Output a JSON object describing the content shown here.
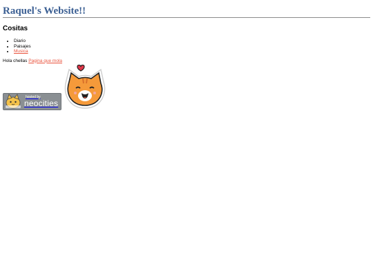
{
  "site": {
    "title": "Raquel's Website!!"
  },
  "cositas": {
    "heading": "Cositas",
    "items": [
      {
        "label": "Diario",
        "is_link": false
      },
      {
        "label": "Paisajes",
        "is_link": false
      },
      {
        "label": "Musica",
        "is_link": true
      }
    ]
  },
  "greeting": {
    "text": "Hola chellas ",
    "link_label": "Pagina que mola"
  },
  "badge": {
    "small_text": "hosted by",
    "big_text": "neocities",
    "icon": "neocities-cat-icon"
  },
  "sticker": {
    "icon": "orange-cat-heart-sticker"
  },
  "colors": {
    "title": "#3b5f93",
    "link": "#e9523c",
    "badge_bg": "#8a8f93",
    "cat_orange": "#f59a3a"
  }
}
